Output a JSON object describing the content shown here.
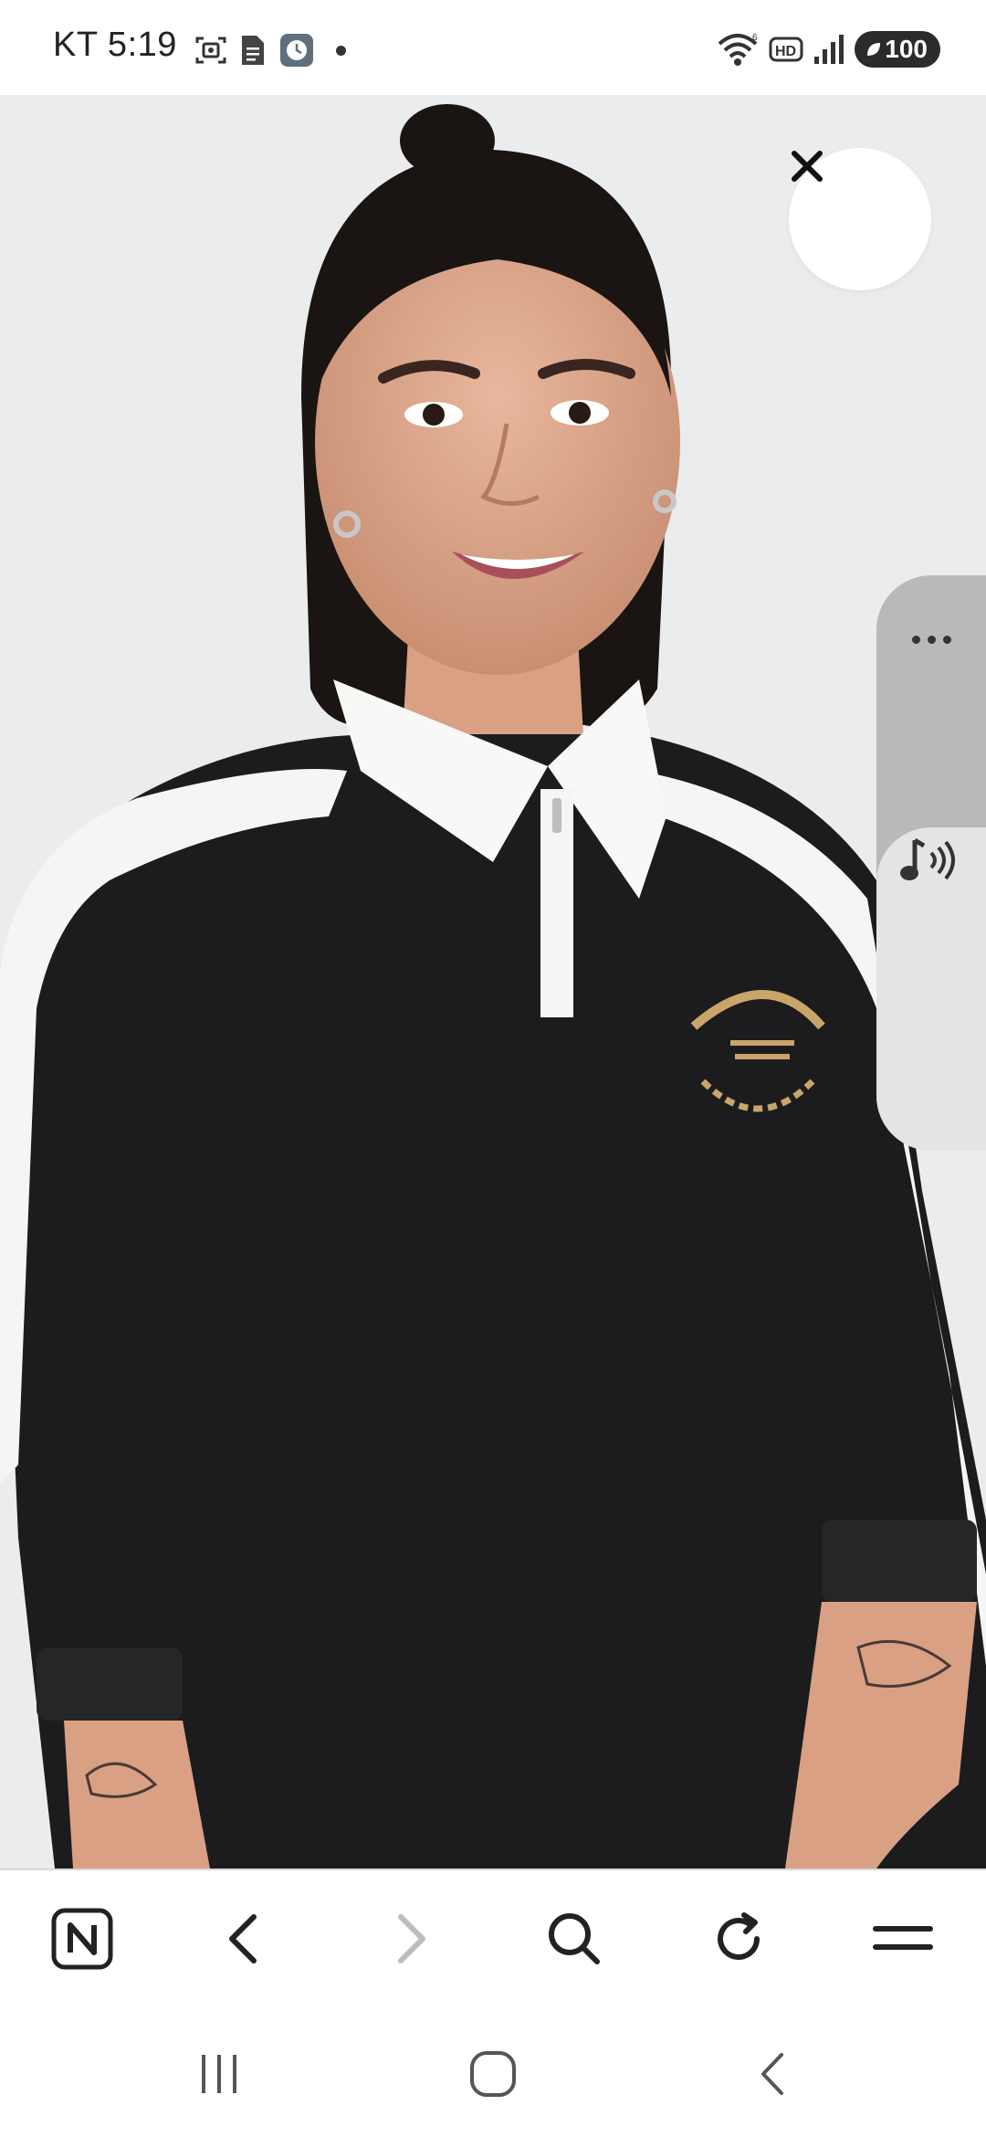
{
  "status_bar": {
    "time": "KT 5:19",
    "battery": "100",
    "notification_icons": [
      "screenshot-icon",
      "document-icon",
      "clock-app-icon"
    ],
    "system_icons": [
      "wifi-icon",
      "hd-icon",
      "signal-icon",
      "battery-icon"
    ]
  },
  "viewer": {
    "image_subject": "product-photo",
    "close_icon": "close-icon",
    "side_panel": {
      "more_icon": "more-dots-icon",
      "sound_icon": "volume-icon"
    }
  },
  "browser_toolbar": {
    "buttons": [
      {
        "icon": "naver-home-icon",
        "enabled": true
      },
      {
        "icon": "back-icon",
        "enabled": true
      },
      {
        "icon": "forward-icon",
        "enabled": false
      },
      {
        "icon": "search-icon",
        "enabled": true
      },
      {
        "icon": "refresh-icon",
        "enabled": true
      },
      {
        "icon": "menu-icon",
        "enabled": true
      }
    ]
  },
  "system_nav": {
    "buttons": [
      "recents-icon",
      "home-icon",
      "system-back-icon"
    ]
  },
  "colors": {
    "photo_background": "#ebecee",
    "sweatshirt": "#1c1c1e",
    "sleeve_stripe": "#f5f5f3",
    "embroidery": "#c9a56a",
    "disabled_icon": "#bdbdbd"
  }
}
